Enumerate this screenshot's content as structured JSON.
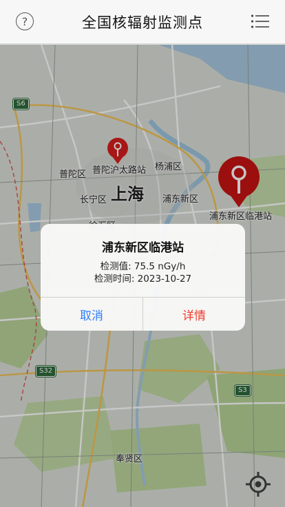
{
  "header": {
    "title": "全国核辐射监测点",
    "help_icon": "question-circle-icon",
    "list_icon": "list-icon"
  },
  "map": {
    "labels": {
      "putuo": "普陀区",
      "yangpu": "杨浦区",
      "changning": "长宁区",
      "shanghai": "上海",
      "pudong": "浦东新区",
      "xuhui": "徐汇区",
      "fengxian": "奉贤区",
      "station_a": "普陀沪太路站",
      "station_b": "浦东新区临港站"
    },
    "shields": {
      "s6": "S6",
      "s32": "S32",
      "s3": "S3"
    },
    "colors": {
      "pin": "#d81e1e",
      "selected_pin": "#c81414"
    }
  },
  "dialog": {
    "title": "浦东新区临港站",
    "value_line": "检测值: 75.5 nGy/h",
    "time_line": "检测时间: 2023-10-27",
    "cancel_label": "取消",
    "detail_label": "详情",
    "colors": {
      "cancel": "#2f7df6",
      "detail": "#ef3b2d"
    }
  },
  "footer": {
    "locate_icon": "locate-crosshair-icon"
  }
}
